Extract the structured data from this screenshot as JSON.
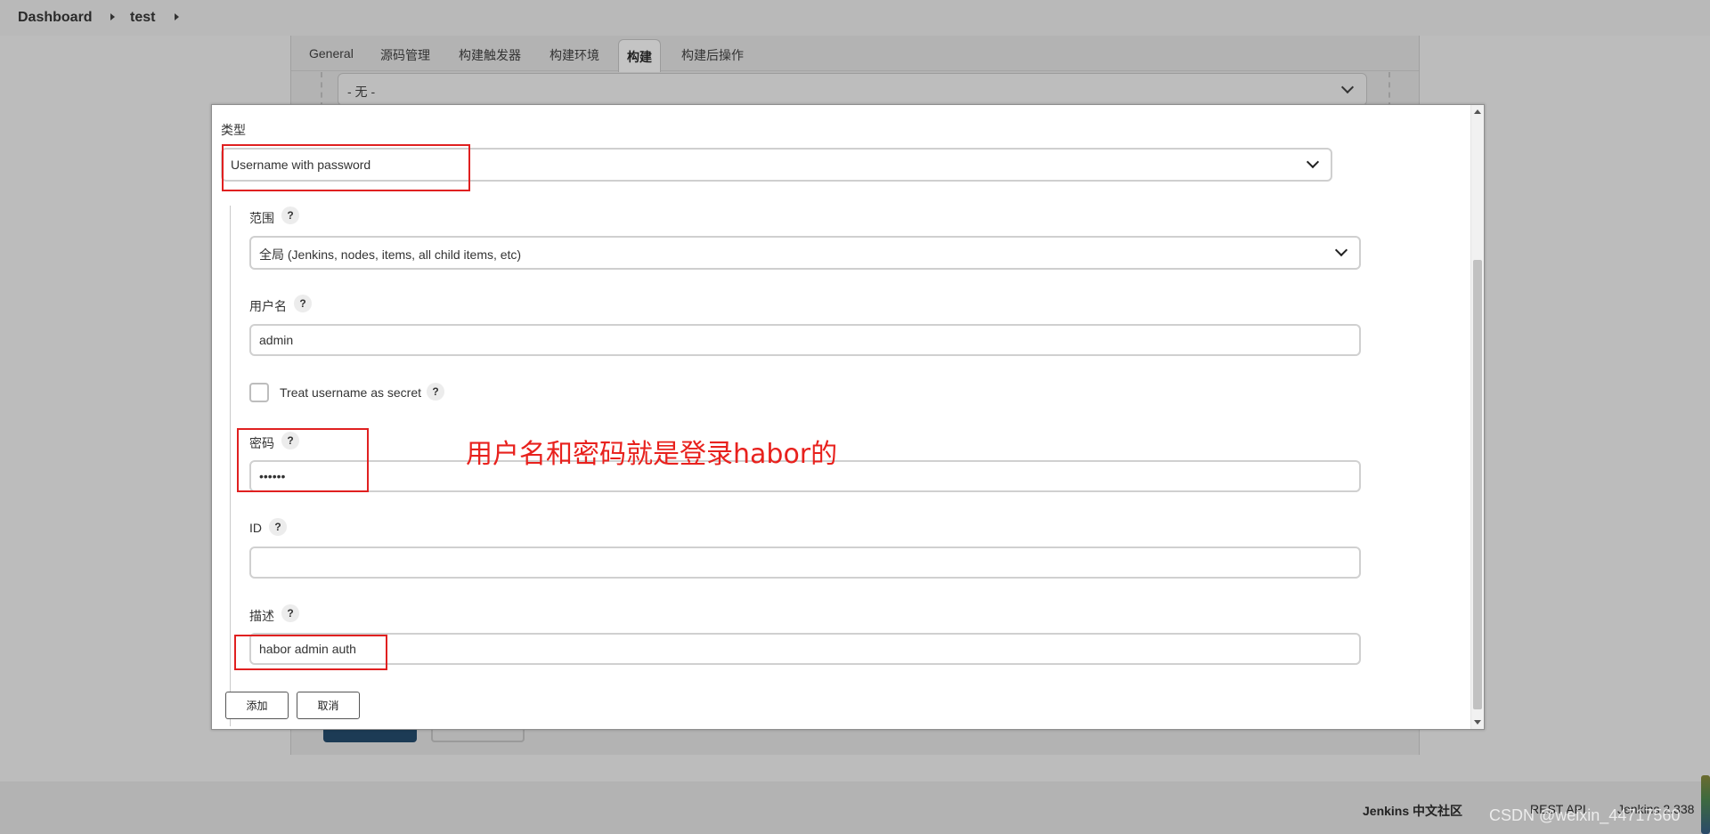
{
  "breadcrumb": {
    "items": [
      "Dashboard",
      "test"
    ]
  },
  "config_page": {
    "tabs": [
      "General",
      "源码管理",
      "构建触发器",
      "构建环境",
      "构建",
      "构建后操作"
    ],
    "active_tab": "构建",
    "credentials_select_value": "- 无 -"
  },
  "dialog": {
    "kind_label": "类型",
    "kind_value": "Username with password",
    "scope_label": "范围",
    "scope_value": "全局 (Jenkins, nodes, items, all child items, etc)",
    "username_label": "用户名",
    "username_value": "admin",
    "treat_secret_label": "Treat username as secret",
    "treat_secret_checked": false,
    "password_label": "密码",
    "password_value": "••••••",
    "id_label": "ID",
    "id_value": "",
    "description_label": "描述",
    "description_value": "habor admin auth",
    "help_glyph": "?",
    "add_button": "添加",
    "cancel_button": "取消"
  },
  "annotation": {
    "text": "用户名和密码就是登录habor的",
    "color": "#e8211d"
  },
  "footer": {
    "community_link": "Jenkins 中文社区",
    "rest_api_link": "REST API",
    "version": "Jenkins 2.338"
  },
  "watermark": "CSDN @weixin_44717560",
  "colors": {
    "highlight_box": "#e02020",
    "primary_button": "#1c3b55"
  }
}
